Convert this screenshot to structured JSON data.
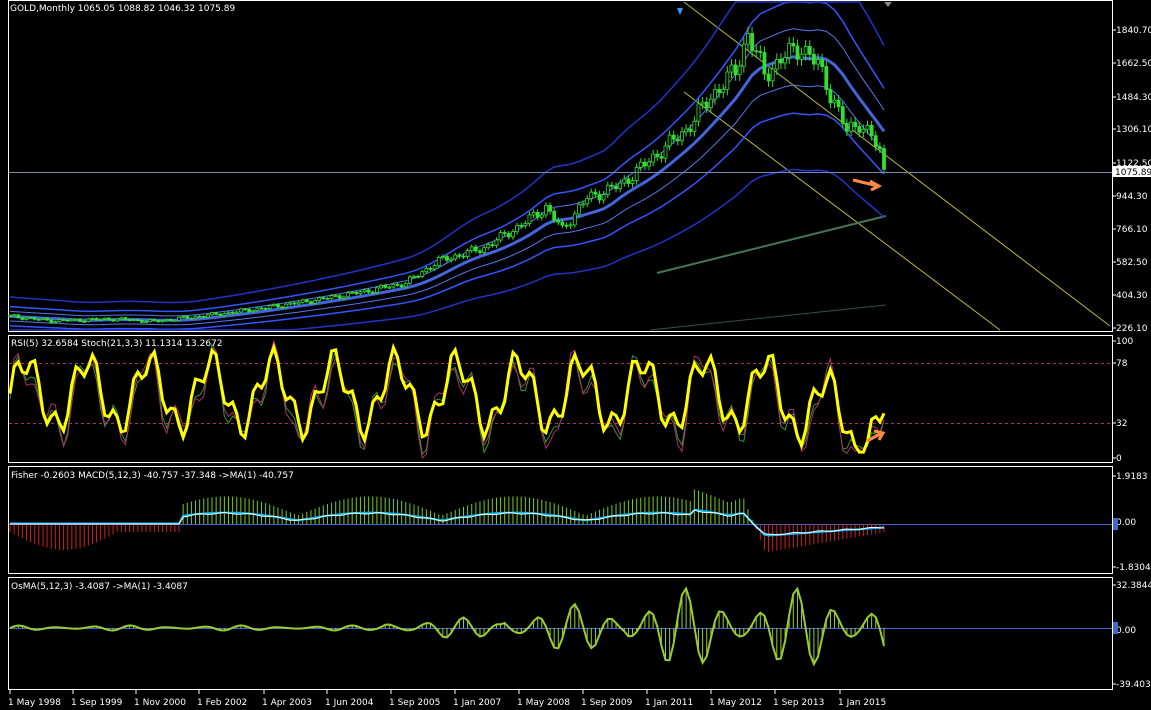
{
  "window": {
    "symbol_label": "GOLD,Monthly",
    "ohlc": "1065.05 1088.82 1046.32 1075.89"
  },
  "panels": {
    "price": {
      "title": "GOLD,Monthly  1065.05 1088.82 1046.32 1075.89",
      "current_price": "1075.89",
      "y_ticks": [
        "1840.70",
        "1662.50",
        "1484.30",
        "1306.10",
        "1122.50",
        "944.30",
        "766.10",
        "582.50",
        "404.30",
        "226.10"
      ],
      "ylim": [
        226.1,
        1840.7
      ]
    },
    "rsi_stoch": {
      "title": "RSI(5) 32.6584  Stoch(21,3,3) 11.1314 13.2672",
      "y_ticks": [
        "100",
        "78",
        "32",
        "0"
      ]
    },
    "fisher_macd": {
      "title": "Fisher -0.2603  MACD(5,12,3) -40.757 -37.348  ->MA(1) -40.757",
      "y_ticks": [
        "1.9183",
        "0.00",
        "-1.8304"
      ]
    },
    "osma": {
      "title": "OsMA(5,12,3) -3.4087  ->MA(1) -3.4087",
      "y_ticks": [
        "32.3844",
        "0.00",
        "-39.4037"
      ]
    }
  },
  "x_axis": {
    "labels": [
      "1 May 1998",
      "1 Sep 1999",
      "1 Nov 2000",
      "1 Feb 2002",
      "1 Apr 2003",
      "1 Jun 2004",
      "1 Sep 2005",
      "1 Jan 2007",
      "1 May 2008",
      "1 Sep 2009",
      "1 Jan 2011",
      "1 May 2012",
      "1 Sep 2013",
      "1 Jan 2015"
    ]
  },
  "colors": {
    "background": "#000000",
    "candle_up": "#33dd33",
    "bands": "#3355ff",
    "rsi": "#ffff00",
    "macd_line": "#00bbff",
    "histogram_pos": "#77cc22",
    "histogram_neg": "#cc2222",
    "osma": "#99cc33",
    "trendline": "#cccc44",
    "arrow": "#ff8844"
  },
  "chart_data": [
    {
      "type": "candlestick",
      "title": "GOLD,Monthly",
      "series": [
        {
          "name": "GOLD",
          "x": [
            "1998-05",
            "1999-09",
            "2000-11",
            "2002-02",
            "2003-04",
            "2004-06",
            "2005-09",
            "2007-01",
            "2008-05",
            "2009-09",
            "2011-01",
            "2011-09",
            "2012-05",
            "2013-09",
            "2015-01",
            "2015-11"
          ],
          "values": [
            290,
            260,
            265,
            295,
            330,
            395,
            470,
            635,
            870,
            1000,
            1350,
            1830,
            1650,
            1330,
            1250,
            1075.89
          ]
        }
      ],
      "ylim": [
        226.1,
        1840.7
      ]
    },
    {
      "type": "line",
      "title": "RSI(5) Stoch(21,3,3)",
      "series": [
        {
          "name": "RSI(5)",
          "values": [
            55,
            30,
            70,
            45,
            80,
            60,
            85,
            50,
            90,
            55,
            75,
            30,
            70,
            45,
            80,
            20,
            60,
            35,
            70,
            32.66
          ]
        },
        {
          "name": "Stoch(21,3,3)",
          "values": [
            50,
            25,
            65,
            40,
            85,
            55,
            90,
            45,
            95,
            50,
            80,
            25,
            65,
            40,
            85,
            10,
            55,
            20,
            40,
            11.13
          ]
        }
      ],
      "ylim": [
        0,
        100
      ]
    },
    {
      "type": "bar",
      "title": "Fisher MACD(5,12,3)",
      "series": [
        {
          "name": "MACD(5,12,3)",
          "values": [
            -0.2,
            -0.5,
            -1.0,
            -0.3,
            0.8,
            1.1,
            0.6,
            0.4,
            1.0,
            1.3,
            0.2,
            1.0,
            1.4,
            1.9,
            0.3,
            -1.8,
            -0.9,
            -0.4,
            -0.26
          ]
        }
      ],
      "ylim": [
        -1.8304,
        1.9183
      ]
    },
    {
      "type": "line",
      "title": "OsMA(5,12,3)",
      "series": [
        {
          "name": "OsMA(5,12,3)",
          "values": [
            0,
            1,
            -1,
            2,
            0,
            3,
            -2,
            5,
            -5,
            12,
            -15,
            20,
            -25,
            32,
            -35,
            18,
            -10,
            8,
            -3.41
          ]
        }
      ],
      "ylim": [
        -39.4037,
        32.3844
      ]
    }
  ]
}
